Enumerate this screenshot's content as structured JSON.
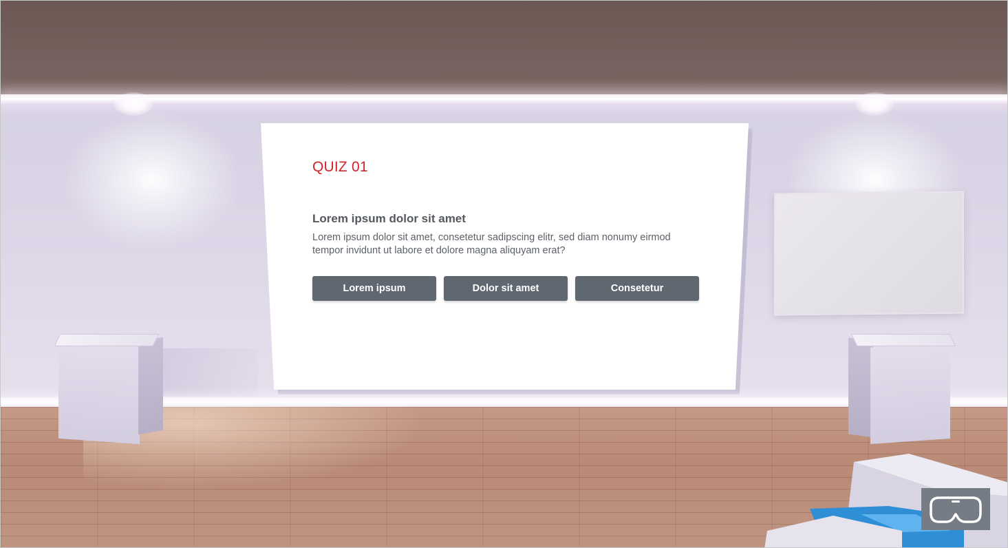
{
  "quiz": {
    "label": "QUIZ 01",
    "heading": "Lorem ipsum dolor sit amet",
    "body": "Lorem ipsum dolor sit amet, consetetur sadipscing elitr, sed diam nonumy eirmod tempor invidunt ut labore et dolore magna aliquyam erat?",
    "answers": [
      {
        "label": "Lorem ipsum"
      },
      {
        "label": "Dolor sit amet"
      },
      {
        "label": "Consetetur"
      }
    ]
  },
  "controls": {
    "vr_icon": "vr-headset-icon"
  },
  "colors": {
    "accent": "#d0242c",
    "button": "#5f6770",
    "vr_button": "#767c85"
  }
}
